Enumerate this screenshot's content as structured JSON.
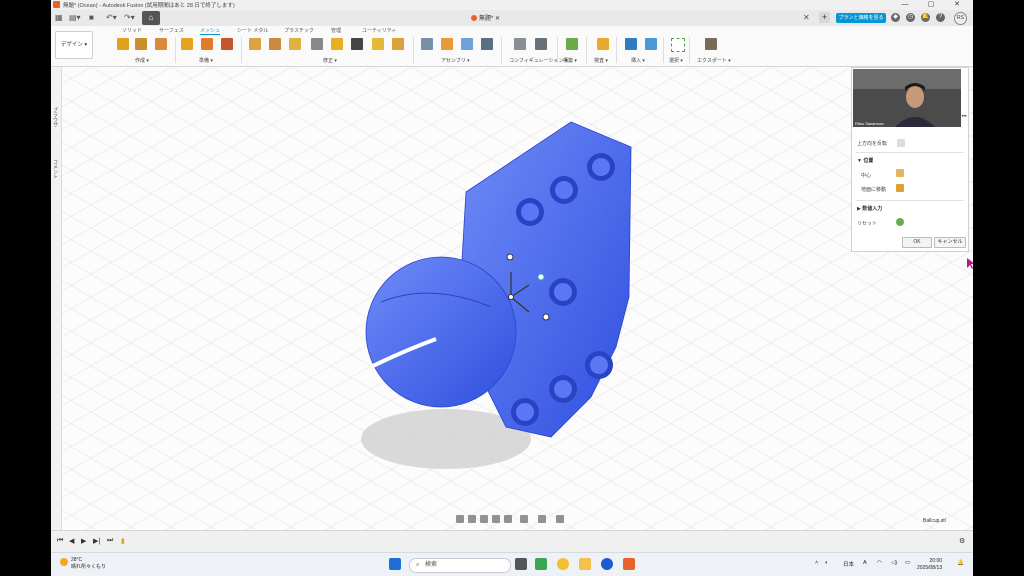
{
  "window": {
    "title": "無題* (Ocean) - Autodesk Fusion (試用期間はあと 28 日で終了します)"
  },
  "tabbar": {
    "doc_tab": "無題*",
    "buy_button": "プランと価格を見る",
    "user_initials": "RS"
  },
  "ribbon": {
    "workspace": "デザイン ▾",
    "tabs": [
      "ソリッド",
      "サーフェス",
      "メッシュ",
      "シート メタル",
      "プラスチック",
      "管理",
      "ユーティリティ"
    ],
    "active_tab": "メッシュ",
    "groups": [
      "作成 ▾",
      "準備 ▾",
      "修正 ▾",
      "アセンブリ ▾",
      "コンフィギュレーション ▾",
      "構築 ▾",
      "検査 ▾",
      "挿入 ▾",
      "選択 ▾",
      "エクスポート ▾"
    ]
  },
  "side": {
    "browser": "ブラウザ",
    "comments": "コメント"
  },
  "panel": {
    "presenter": "Ritsu Sasamura",
    "flip_label": "上方向を反転",
    "position_header": "▼ 位置",
    "center_label": "中心",
    "ground_label": "地面に移動",
    "numeric_header": "▶ 数値入力",
    "reset_label": "リセット",
    "ok": "OK",
    "cancel": "キャンセル"
  },
  "canvas": {
    "file_name": "Ballcup.stl"
  },
  "taskbar": {
    "temp": "28°C",
    "weather": "晴れ所々くもり",
    "search_placeholder": "検索",
    "language": "日本",
    "time": "20:00",
    "date": "2025/08/13"
  },
  "colors": {
    "model": "#4a6cf0",
    "accent": "#0696d7",
    "brand": "#e8622a"
  }
}
